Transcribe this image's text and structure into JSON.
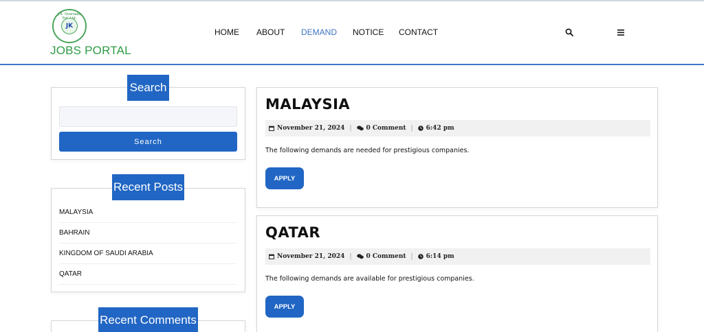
{
  "brand": {
    "name": "JOBS PORTAL",
    "logo_ring_text": "J.K. Overseas Pvt. Ltd.",
    "logo_mark": "JK"
  },
  "nav": {
    "items": [
      {
        "label": "HOME",
        "active": false
      },
      {
        "label": "ABOUT",
        "active": false
      },
      {
        "label": "DEMAND",
        "active": true
      },
      {
        "label": "NOTICE",
        "active": false
      },
      {
        "label": "CONTACT",
        "active": false
      }
    ],
    "search_icon": "search-icon",
    "menu_icon": "hamburger-menu-icon"
  },
  "sidebar": {
    "search": {
      "title": "Search",
      "placeholder": "",
      "button_label": "Search"
    },
    "recent_posts": {
      "title": "Recent Posts",
      "items": [
        "MALAYSIA",
        "BAHRAIN",
        "KINGDOM OF SAUDI ARABIA",
        "QATAR"
      ]
    },
    "recent_comments": {
      "title": "Recent Comments"
    }
  },
  "posts": [
    {
      "title": "MALAYSIA",
      "date": "November 21, 2024",
      "comments": "0 Comment",
      "time": "6:42 pm",
      "excerpt": "The following demands are needed for prestigious companies.",
      "button_label": "APPLY"
    },
    {
      "title": "QATAR",
      "date": "November 21, 2024",
      "comments": "0 Comment",
      "time": "6:14 pm",
      "excerpt": "The following demands are available for prestigious companies.",
      "button_label": "APPLY"
    }
  ],
  "colors": {
    "accent": "#2166c4",
    "brand_green": "#2f9a45",
    "header_rule": "#3f74c4"
  }
}
